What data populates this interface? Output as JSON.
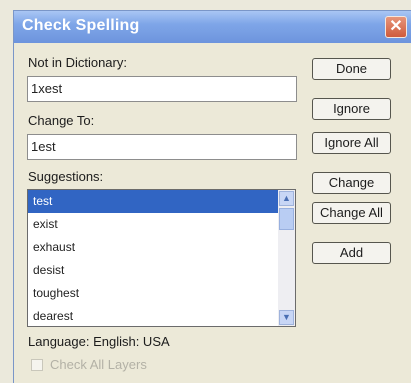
{
  "window": {
    "title": "Check Spelling"
  },
  "not_in_dictionary": {
    "label": "Not in Dictionary:",
    "value": "1xest"
  },
  "change_to": {
    "label": "Change To:",
    "value": "1est"
  },
  "suggestions": {
    "label": "Suggestions:",
    "items": [
      "test",
      "exist",
      "exhaust",
      "desist",
      "toughest",
      "dearest"
    ],
    "selected_index": 0
  },
  "buttons": {
    "done": "Done",
    "ignore": "Ignore",
    "ignore_all": "Ignore All",
    "change": "Change",
    "change_all": "Change All",
    "add": "Add"
  },
  "language": "Language: English: USA",
  "check_all_layers": {
    "label": "Check All Layers",
    "checked": false,
    "enabled": false
  },
  "icons": {
    "close": "close-icon",
    "scroll_up": "chevron-up-icon",
    "scroll_down": "chevron-down-icon"
  },
  "colors": {
    "title_bar": "#7fa6e8",
    "selection": "#3165c3",
    "close_button": "#cf5b3c"
  }
}
